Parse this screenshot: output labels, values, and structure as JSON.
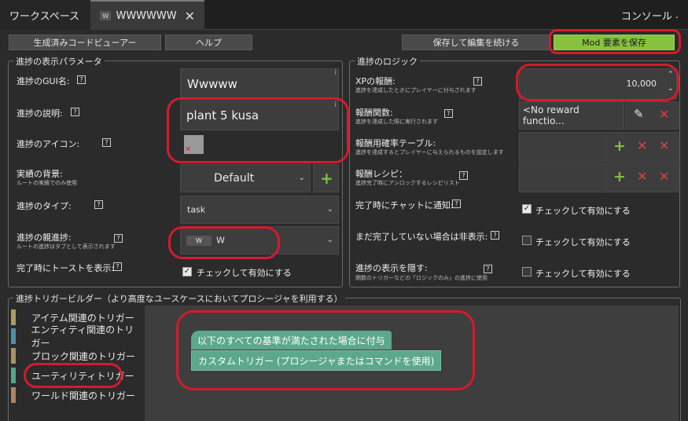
{
  "tabs": [
    {
      "label": "ワークスペース"
    },
    {
      "label": "WWWWWW",
      "thumb": "W"
    }
  ],
  "console_label": "コンソール",
  "toolbar": {
    "code_viewer": "生成済みコードビューアー",
    "help": "ヘルプ",
    "save_continue": "保存して編集を続ける",
    "save_mod": "Mod 要素を保存"
  },
  "display_params": {
    "title": "進捗の表示パラメータ",
    "gui_name_label": "進捗のGUI名:",
    "gui_name_value": "Wwwww",
    "description_label": "進捗の説明:",
    "description_value": "plant 5 kusa",
    "icon_label": "進捗のアイコン:",
    "background_label": "実績の背景:",
    "background_sub": "ルートの実績でのみ使用",
    "background_value": "Default",
    "type_label": "進捗のタイプ:",
    "type_value": "task",
    "parent_label": "進捗の親進捗:",
    "parent_sub": "ルートの進捗はタブとして表示されます",
    "parent_thumb": "W",
    "parent_value": "W",
    "toast_label": "完了時にトーストを表示:",
    "toast_check": "チェックして有効にする"
  },
  "logic": {
    "title": "進捗のロジック",
    "xp_label": "XPの報酬:",
    "xp_sub": "進捗を達成したときにプレイヤーに付与されます",
    "xp_value": "10,000",
    "func_label": "報酬関数:",
    "func_sub": "進捗を達成した際に実行されます",
    "func_value": "<No reward functio...",
    "loot_label": "報酬用確率テーブル:",
    "loot_sub": "進捗を達成するとプレイヤーに与えられるものを設定します",
    "recipe_label": "報酬レシピ：",
    "recipe_sub": "進捗完了時にアンロックするレシピリスト",
    "chat_label": "完了時にチャットに通知:",
    "chat_check": "チェックして有効にする",
    "hide_unfinished_label": "まだ完了していない場合は非表示:",
    "hide_unfinished_check": "チェックして有効にする",
    "hide_display_label": "進捗の表示を隠す:",
    "hide_display_sub": "関数のトリガーなどの「ロジックのみ」の進捗に使用",
    "hide_display_check": "チェックして有効にする"
  },
  "builder": {
    "title": "進捗トリガービルダー（より高度なユースケースにおいてプロシージャを利用する）",
    "categories": [
      {
        "label": "アイテム関連のトリガー",
        "color": "#a8a05c"
      },
      {
        "label": "エンティティ関連のトリガー",
        "color": "#4f8fa8"
      },
      {
        "label": "ブロック関連のトリガー",
        "color": "#a8926a"
      },
      {
        "label": "ユーティリティトリガー",
        "color": "#4fa88a"
      },
      {
        "label": "ワールド関連のトリガー",
        "color": "#a8866a"
      }
    ],
    "block_top": "以下のすべての基準が満たされた場合に付与",
    "block_bottom": "カスタムトリガー (プロシージャまたはコマンドを使用)"
  },
  "colors": {
    "accent_green": "#86c23e",
    "annotation_red": "#d41b2c",
    "block_green": "#5ca88a"
  },
  "icons": [
    "close-icon",
    "help-icon",
    "chevron-down-icon",
    "plus-icon",
    "delete-icon",
    "pencil-icon",
    "spinner-up-icon",
    "spinner-down-icon"
  ]
}
